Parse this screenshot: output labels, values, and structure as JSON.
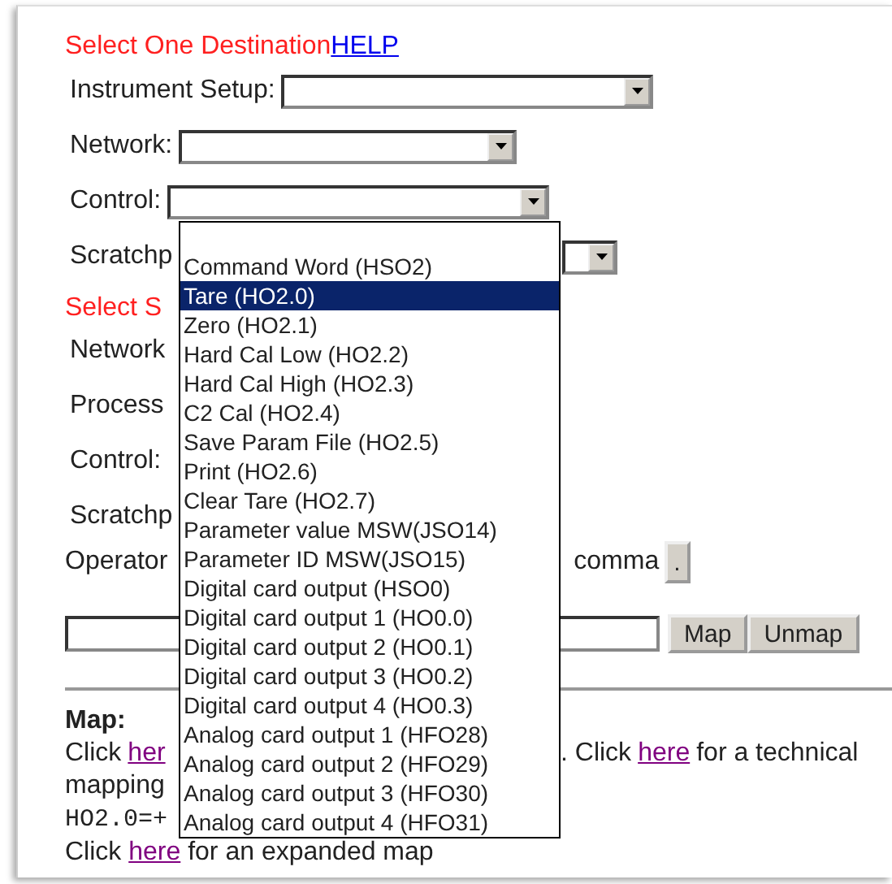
{
  "destination": {
    "heading": "Select One Destination",
    "help_link": "HELP",
    "fields": [
      {
        "label": "Instrument Setup:",
        "kind": "full"
      },
      {
        "label": "Network:",
        "kind": "full"
      },
      {
        "label": "Control:",
        "kind": "full"
      },
      {
        "label": "Scratchp",
        "kind": "tail"
      }
    ]
  },
  "source": {
    "heading": "Select S",
    "fields": [
      {
        "label": "Network"
      },
      {
        "label": "Process"
      },
      {
        "label": "Control:"
      },
      {
        "label": "Scratchp"
      }
    ]
  },
  "operator_row": {
    "label": "Operator",
    "suffix": "comma",
    "button": "."
  },
  "map_row": {
    "buttons": [
      "Map",
      "Unmap"
    ]
  },
  "map_section": {
    "heading": "Map:",
    "lines": [
      {
        "kind": "split",
        "left": [
          {
            "kind": "text",
            "text": "Click"
          },
          {
            "kind": "link",
            "text": "her"
          }
        ],
        "right": [
          {
            "kind": "text",
            "text": ". Click"
          },
          {
            "kind": "link",
            "text": "here"
          },
          {
            "kind": "text",
            "text": "for a technical"
          }
        ]
      },
      {
        "kind": "plain",
        "text": "mapping"
      },
      {
        "kind": "code",
        "text": "HO2.0=+"
      },
      {
        "kind": "sentence",
        "parts": [
          {
            "kind": "text",
            "text": "Click "
          },
          {
            "kind": "link",
            "text": "here"
          },
          {
            "kind": "text",
            "text": " for an expanded map"
          }
        ]
      }
    ]
  },
  "dropdown": {
    "options": [
      {
        "label": "Command Word (HSO2)",
        "selected": false
      },
      {
        "label": "Tare (HO2.0)",
        "selected": true
      },
      {
        "label": "Zero (HO2.1)",
        "selected": false
      },
      {
        "label": "Hard Cal Low (HO2.2)",
        "selected": false
      },
      {
        "label": "Hard Cal High (HO2.3)",
        "selected": false
      },
      {
        "label": "C2 Cal (HO2.4)",
        "selected": false
      },
      {
        "label": "Save Param File (HO2.5)",
        "selected": false
      },
      {
        "label": "Print (HO2.6)",
        "selected": false
      },
      {
        "label": "Clear Tare (HO2.7)",
        "selected": false
      },
      {
        "label": "Parameter value MSW(JSO14)",
        "selected": false
      },
      {
        "label": "Parameter ID MSW(JSO15)",
        "selected": false
      },
      {
        "label": "Digital card output (HSO0)",
        "selected": false
      },
      {
        "label": "Digital card output 1 (HO0.0)",
        "selected": false
      },
      {
        "label": "Digital card output 2 (HO0.1)",
        "selected": false
      },
      {
        "label": "Digital card output 3 (HO0.2)",
        "selected": false
      },
      {
        "label": "Digital card output 4 (HO0.3)",
        "selected": false
      },
      {
        "label": "Analog card output 1 (HFO28)",
        "selected": false
      },
      {
        "label": "Analog card output 2 (HFO29)",
        "selected": false
      },
      {
        "label": "Analog card output 3 (HFO30)",
        "selected": false
      },
      {
        "label": "Analog card output 4 (HFO31)",
        "selected": false
      }
    ]
  }
}
